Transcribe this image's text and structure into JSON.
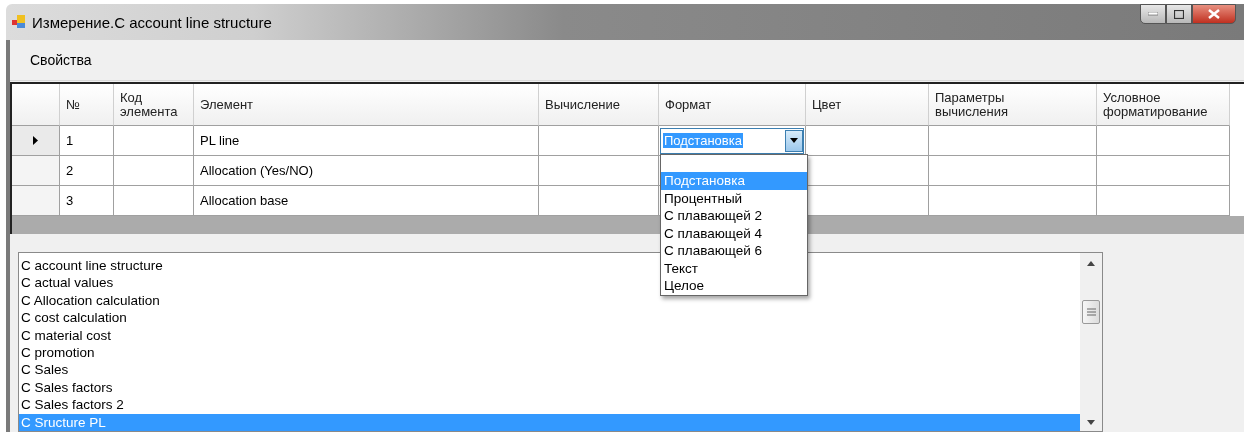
{
  "window": {
    "title": "Измерение.C account line structure"
  },
  "menu": [
    {
      "label": "Свойства"
    }
  ],
  "grid": {
    "columns": [
      {
        "label": "№"
      },
      {
        "label": "Код элемента"
      },
      {
        "label": "Элемент"
      },
      {
        "label": "Вычисление"
      },
      {
        "label": "Формат"
      },
      {
        "label": "Цвет"
      },
      {
        "label": "Параметры вычисления"
      },
      {
        "label": "Условное форматирование"
      }
    ],
    "rows": [
      {
        "selected": true,
        "cells": [
          "1",
          null,
          "PL line",
          null,
          {
            "kind": "combo",
            "value": "Подстановка",
            "expanded": true,
            "options": [
              {
                "label": "Подстановка",
                "selected": true
              },
              {
                "label": "Процентный",
                "selected": false
              },
              {
                "label": "С плавающей 2",
                "selected": false
              },
              {
                "label": "С плавающей 4",
                "selected": false
              },
              {
                "label": "С плавающей 6",
                "selected": false
              },
              {
                "label": "Текст",
                "selected": false
              },
              {
                "label": "Целое",
                "selected": false
              }
            ]
          },
          null,
          null,
          null
        ]
      },
      {
        "selected": false,
        "cells": [
          "2",
          null,
          "Allocation (Yes/NO)",
          null,
          null,
          null,
          null,
          null
        ]
      },
      {
        "selected": false,
        "cells": [
          "3",
          null,
          "Allocation base",
          null,
          null,
          null,
          null,
          null
        ]
      }
    ]
  },
  "list": {
    "items": [
      {
        "label": "C account line structure",
        "selected": false
      },
      {
        "label": "C actual values",
        "selected": false
      },
      {
        "label": "C Allocation calculation",
        "selected": false
      },
      {
        "label": "C cost calculation",
        "selected": false
      },
      {
        "label": "C material cost",
        "selected": false
      },
      {
        "label": "C promotion",
        "selected": false
      },
      {
        "label": "C Sales",
        "selected": false
      },
      {
        "label": "C Sales factors",
        "selected": false
      },
      {
        "label": "C Sales factors 2",
        "selected": false
      },
      {
        "label": "C Sructure PL",
        "selected": true
      }
    ]
  }
}
